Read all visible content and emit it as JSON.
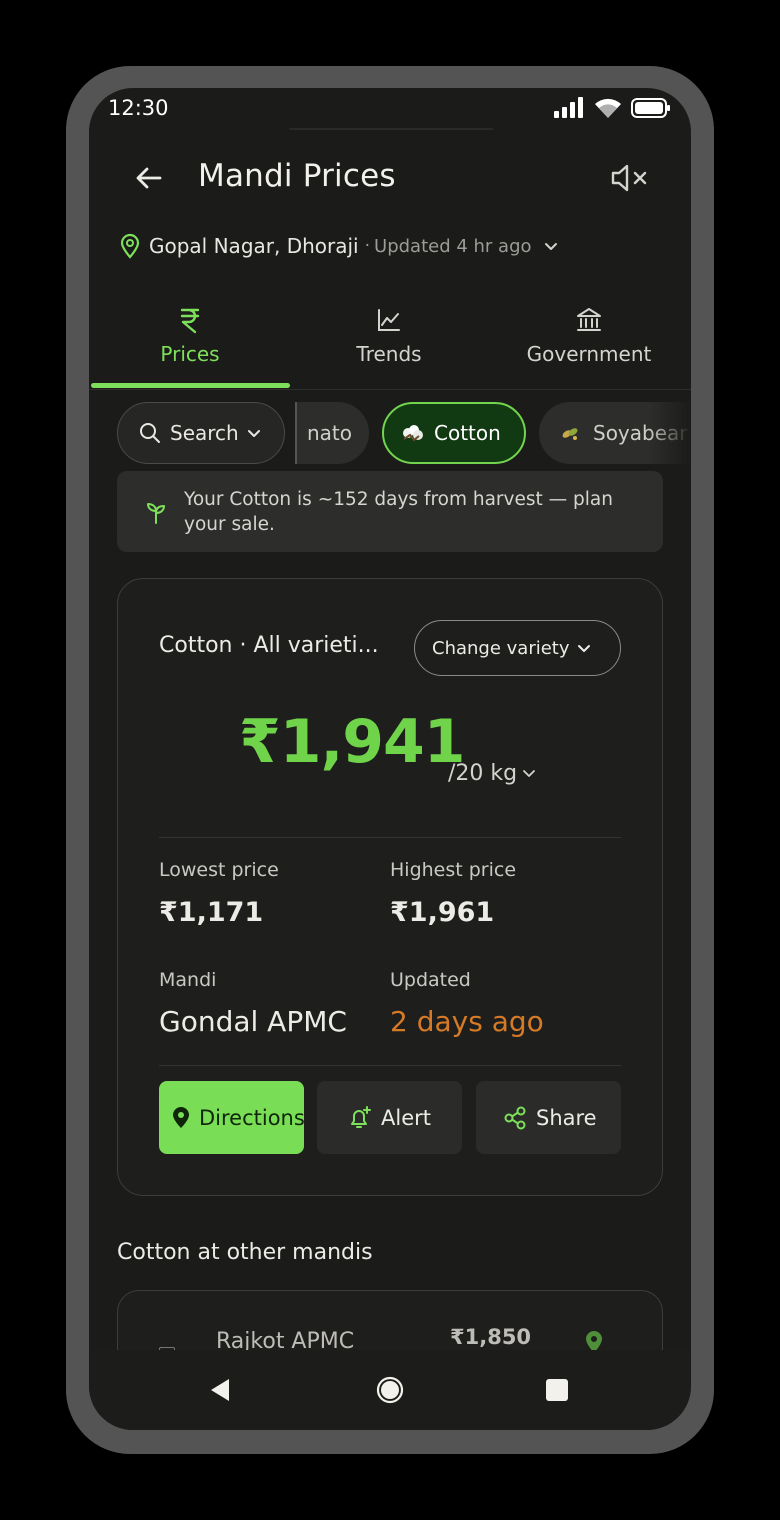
{
  "status_bar": {
    "time": "12:30"
  },
  "header": {
    "title": "Mandi Prices"
  },
  "location": {
    "name": "Gopal Nagar, Dhoraji",
    "separator": "·",
    "updated": "Updated 4 hr ago"
  },
  "tabs": [
    {
      "label": "Prices",
      "icon": "rupee-icon",
      "active": true
    },
    {
      "label": "Trends",
      "icon": "line-chart-icon",
      "active": false
    },
    {
      "label": "Government",
      "icon": "bank-icon",
      "active": false
    }
  ],
  "chips": {
    "search_label": "Search",
    "tomato_label": "nato",
    "cotton_label": "Cotton",
    "soybean_label": "Soyabear"
  },
  "banner": {
    "text": "Your Cotton is ~152 days from harvest — plan your sale."
  },
  "price_card": {
    "variety": "Cotton · All varieti...",
    "change_variety_label": "Change variety",
    "price": "₹1,941",
    "unit": "/20 kg",
    "lowest_label": "Lowest price",
    "lowest_value": "₹1,171",
    "highest_label": "Highest price",
    "highest_value": "₹1,961",
    "mandi_label": "Mandi",
    "mandi_value": "Gondal APMC",
    "updated_label": "Updated",
    "updated_value": "2 days ago",
    "directions_label": "Directions",
    "alert_label": "Alert",
    "share_label": "Share"
  },
  "other_mandis": {
    "title": "Cotton at other mandis",
    "rows": [
      {
        "name": "Rajkot APMC",
        "price": "₹1,850"
      }
    ]
  },
  "colors": {
    "accent": "#79de55",
    "warning": "#d57a26",
    "background": "#1b1b19"
  }
}
